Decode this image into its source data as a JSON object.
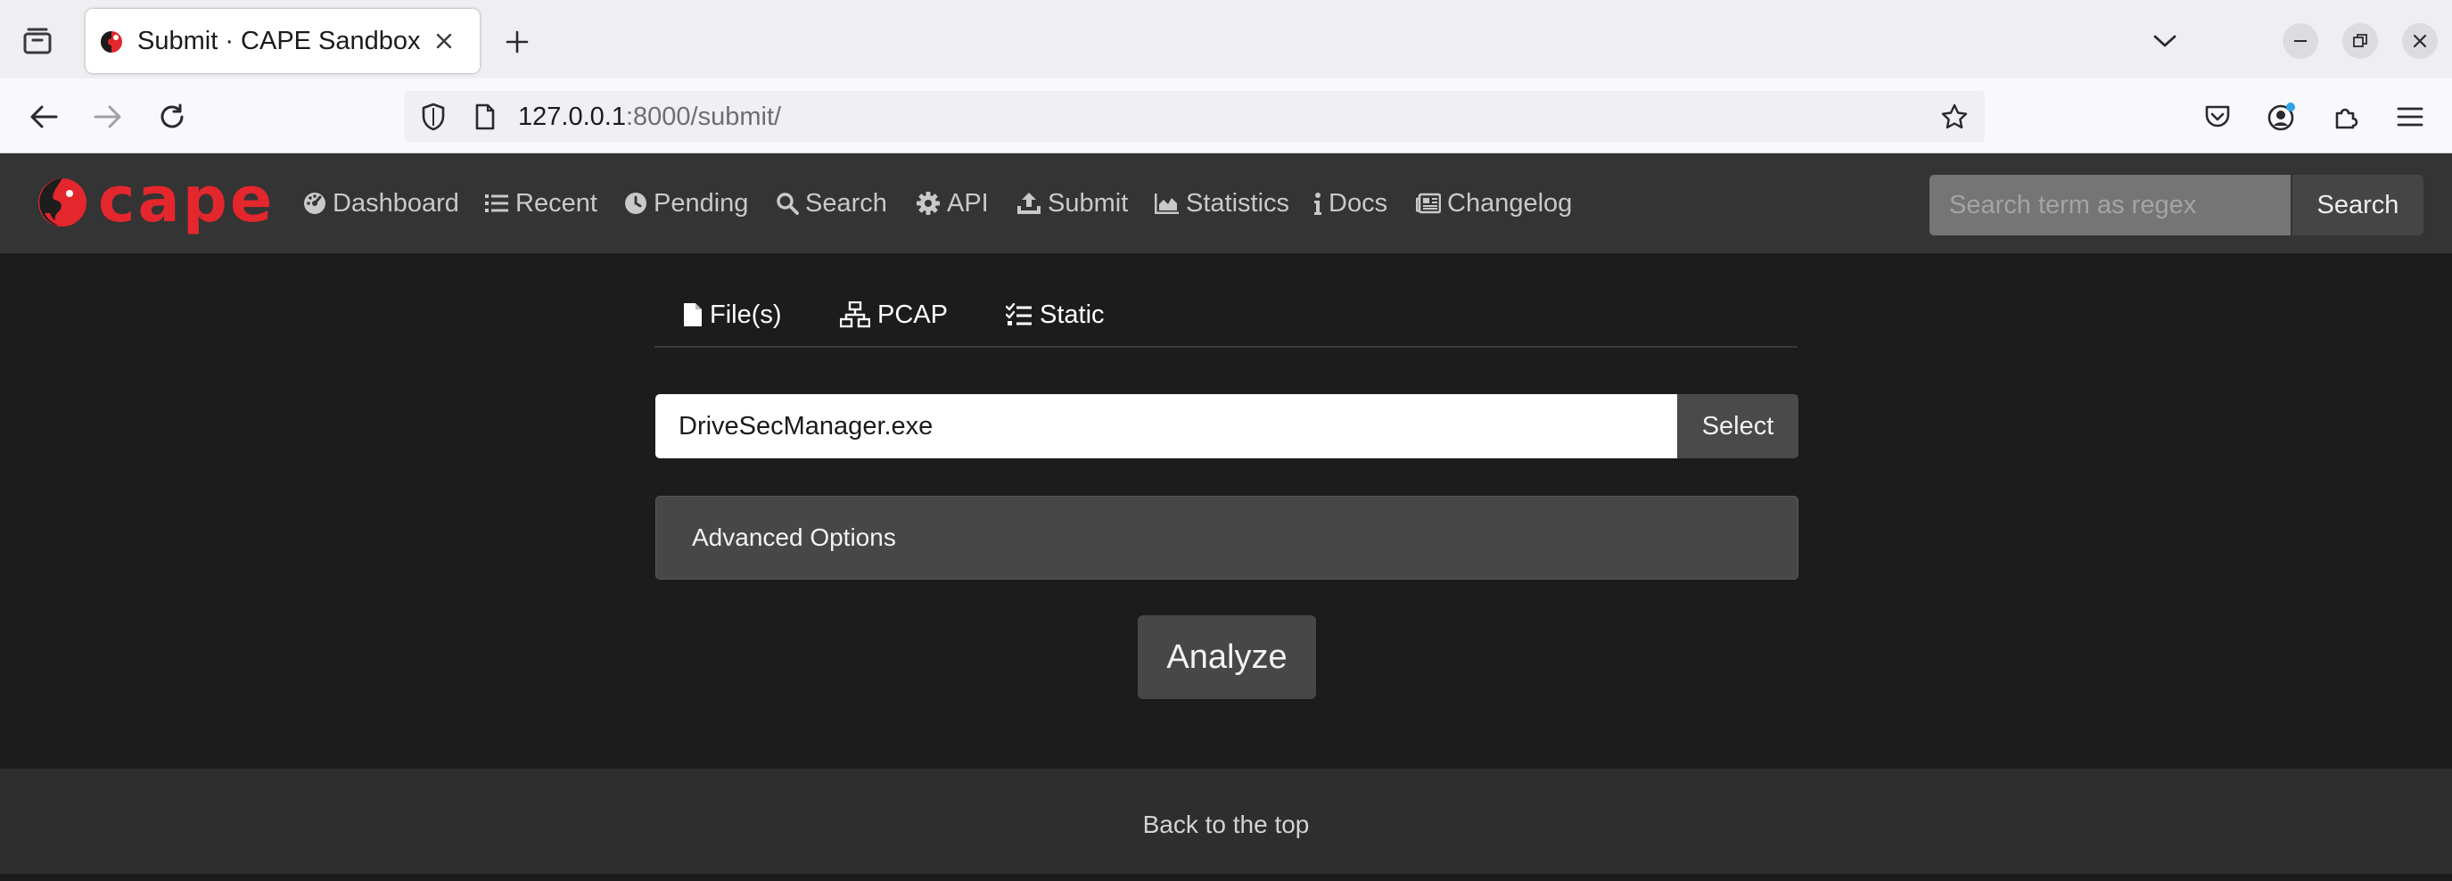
{
  "browser": {
    "tab_title": "Submit · CAPE Sandbox",
    "url_host": "127.0.0.1",
    "url_rest": ":8000/submit/"
  },
  "site": {
    "logo_text": "cape",
    "nav": [
      {
        "label": "Dashboard",
        "icon": "dashboard-icon"
      },
      {
        "label": "Recent",
        "icon": "list-icon"
      },
      {
        "label": "Pending",
        "icon": "clock-icon"
      },
      {
        "label": "Search",
        "icon": "search-icon"
      },
      {
        "label": "API",
        "icon": "gear-icon"
      },
      {
        "label": "Submit",
        "icon": "upload-icon"
      },
      {
        "label": "Statistics",
        "icon": "area-chart-icon"
      },
      {
        "label": "Docs",
        "icon": "info-icon"
      },
      {
        "label": "Changelog",
        "icon": "newspaper-icon"
      }
    ],
    "search_placeholder": "Search term as regex",
    "search_button": "Search"
  },
  "submit": {
    "tabs": [
      {
        "label": "File(s)",
        "icon": "file-icon"
      },
      {
        "label": "PCAP",
        "icon": "network-icon"
      },
      {
        "label": "Static",
        "icon": "tasks-icon"
      }
    ],
    "file_value": "DriveSecManager.exe",
    "select_button": "Select",
    "advanced_label": "Advanced Options",
    "analyze_button": "Analyze"
  },
  "footer": {
    "back_to_top": "Back to the top"
  },
  "colors": {
    "brand_red": "#e4262d",
    "navbar_bg": "#343434",
    "page_bg": "#1c1c1c"
  }
}
